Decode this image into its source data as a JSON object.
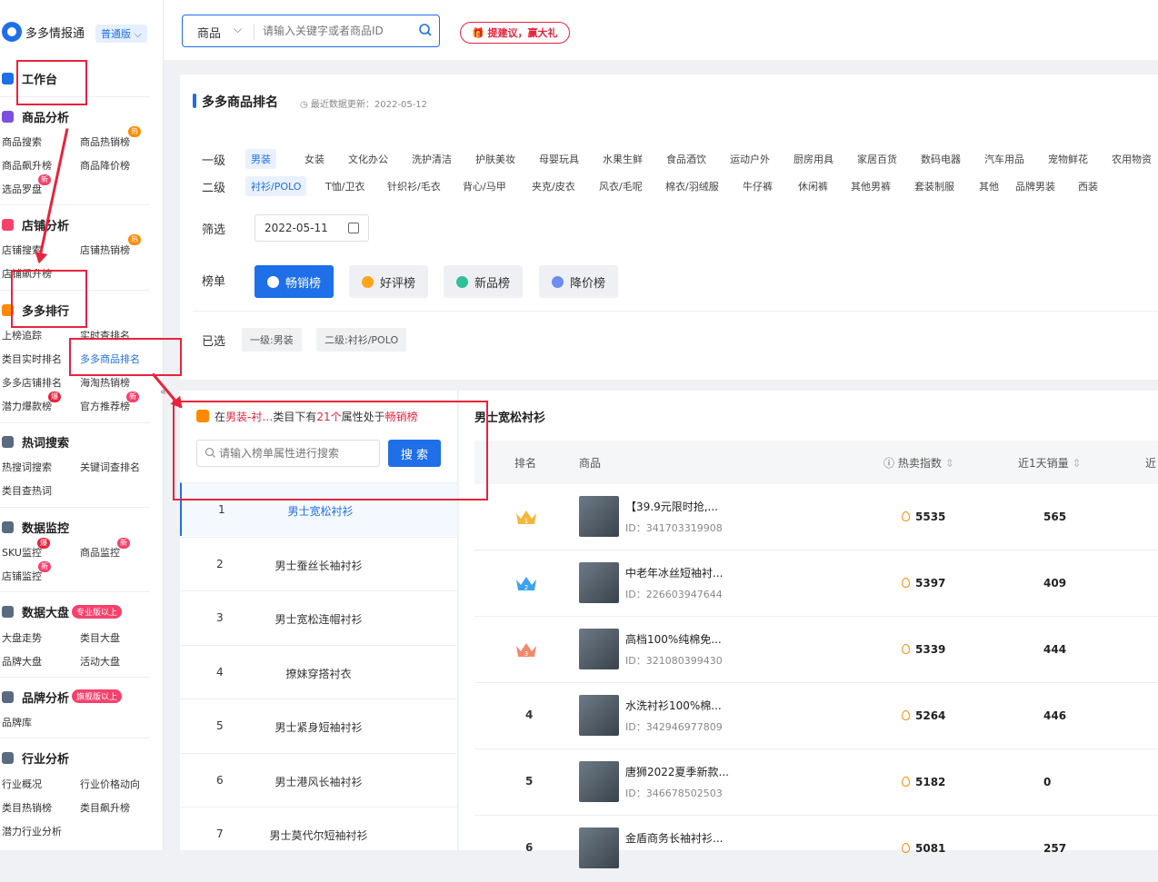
{
  "sidebar": {
    "brand": "多多情报通",
    "edition": "普通版",
    "sections": [
      {
        "title": "工作台",
        "items": []
      },
      {
        "title": "商品分析",
        "items": [
          "商品搜索",
          "商品热销榜",
          "商品飙升榜",
          "商品降价榜",
          "选品罗盘"
        ]
      },
      {
        "title": "店铺分析",
        "items": [
          "店铺搜索",
          "店铺热销榜",
          "店铺飙升榜"
        ]
      },
      {
        "title": "多多排行",
        "items": [
          "上榜追踪",
          "实时查排名",
          "类目实时排名",
          "多多商品排名",
          "多多店铺排名",
          "海淘热销榜",
          "潜力爆款榜",
          "官方推荐榜"
        ]
      },
      {
        "title": "热词搜索",
        "items": [
          "热搜词搜索",
          "关键词查排名",
          "类目查热词"
        ]
      },
      {
        "title": "数据监控",
        "items": [
          "SKU监控",
          "商品监控",
          "店铺监控"
        ]
      },
      {
        "title": "数据大盘",
        "tag": "专业版以上",
        "items": [
          "大盘走势",
          "类目大盘",
          "品牌大盘",
          "活动大盘"
        ]
      },
      {
        "title": "品牌分析",
        "tag": "旗舰版以上",
        "items": [
          "品牌库"
        ]
      },
      {
        "title": "行业分析",
        "items": [
          "行业概况",
          "行业价格动向",
          "类目热销榜",
          "类目飙升榜",
          "潜力行业分析"
        ]
      }
    ],
    "badges": {
      "hot": "热",
      "new": "新",
      "boom": "爆"
    },
    "collapse": "«"
  },
  "topbar": {
    "search_category": "商品",
    "search_placeholder": "请输入关键字或者商品ID",
    "suggest": "提建议，赢大礼"
  },
  "filter": {
    "title": "多多商品排名",
    "update": "最近数据更新：2022-05-12",
    "level1_label": "一级",
    "level1": [
      "男装",
      "女装",
      "文化办公",
      "洗护清洁",
      "护肤美妆",
      "母婴玩具",
      "水果生鲜",
      "食品酒饮",
      "运动户外",
      "厨房用具",
      "家居百货",
      "数码电器",
      "汽车用品",
      "宠物鲜花",
      "农用物资"
    ],
    "level2_label": "二级",
    "level2": [
      "衬衫/POLO",
      "T恤/卫衣",
      "针织衫/毛衣",
      "背心/马甲",
      "夹克/皮衣",
      "风衣/毛呢",
      "棉衣/羽绒服",
      "牛仔裤",
      "休闲裤",
      "其他男裤",
      "套装制服",
      "其他",
      "品牌男装",
      "西装"
    ],
    "filter_label": "筛选",
    "date": "2022-05-11",
    "board_label": "榜单",
    "boards": [
      "畅销榜",
      "好评榜",
      "新品榜",
      "降价榜"
    ],
    "selected_label": "已选",
    "selected": [
      "一级:男装",
      "二级:衬衫/POLO"
    ]
  },
  "left_panel": {
    "notice_parts": [
      "在",
      "男装-衬…",
      "类目下有",
      "21个",
      "属性处于",
      "畅销榜"
    ],
    "search_placeholder": "请输入榜单属性进行搜索",
    "search_button": "搜 索",
    "items": [
      {
        "n": "1",
        "t": "男士宽松衬衫"
      },
      {
        "n": "2",
        "t": "男士蚕丝长袖衬衫"
      },
      {
        "n": "3",
        "t": "男士宽松连帽衬衫"
      },
      {
        "n": "4",
        "t": "撩妹穿搭衬衣"
      },
      {
        "n": "5",
        "t": "男士紧身短袖衬衫"
      },
      {
        "n": "6",
        "t": "男士港风长袖衬衫"
      },
      {
        "n": "7",
        "t": "男士莫代尔短袖衬衫"
      }
    ]
  },
  "right_panel": {
    "title": "男士宽松衬衫",
    "headers": {
      "rank": "排名",
      "product": "商品",
      "hot": "热卖指数",
      "sales": "近1天销量",
      "more": "近"
    },
    "rows": [
      {
        "rank": "1",
        "name": "【39.9元限时抢,...",
        "id": "ID：341703319908",
        "hot": "5535",
        "sales": "565"
      },
      {
        "rank": "2",
        "name": "中老年冰丝短袖衬...",
        "id": "ID：226603947644",
        "hot": "5397",
        "sales": "409"
      },
      {
        "rank": "3",
        "name": "高档100%纯棉免...",
        "id": "ID：321080399430",
        "hot": "5339",
        "sales": "444"
      },
      {
        "rank": "4",
        "name": "水洗衬衫100%棉...",
        "id": "ID：342946977809",
        "hot": "5264",
        "sales": "446"
      },
      {
        "rank": "5",
        "name": "唐狮2022夏季新款...",
        "id": "ID：346678502503",
        "hot": "5182",
        "sales": "0"
      },
      {
        "rank": "6",
        "name": "金盾商务长袖衬衫...",
        "id": "",
        "hot": "5081",
        "sales": "257"
      }
    ]
  },
  "colors": {
    "accent": "#1e6fe8",
    "annotation": "#e8233b",
    "hot": "#ff8a00"
  }
}
